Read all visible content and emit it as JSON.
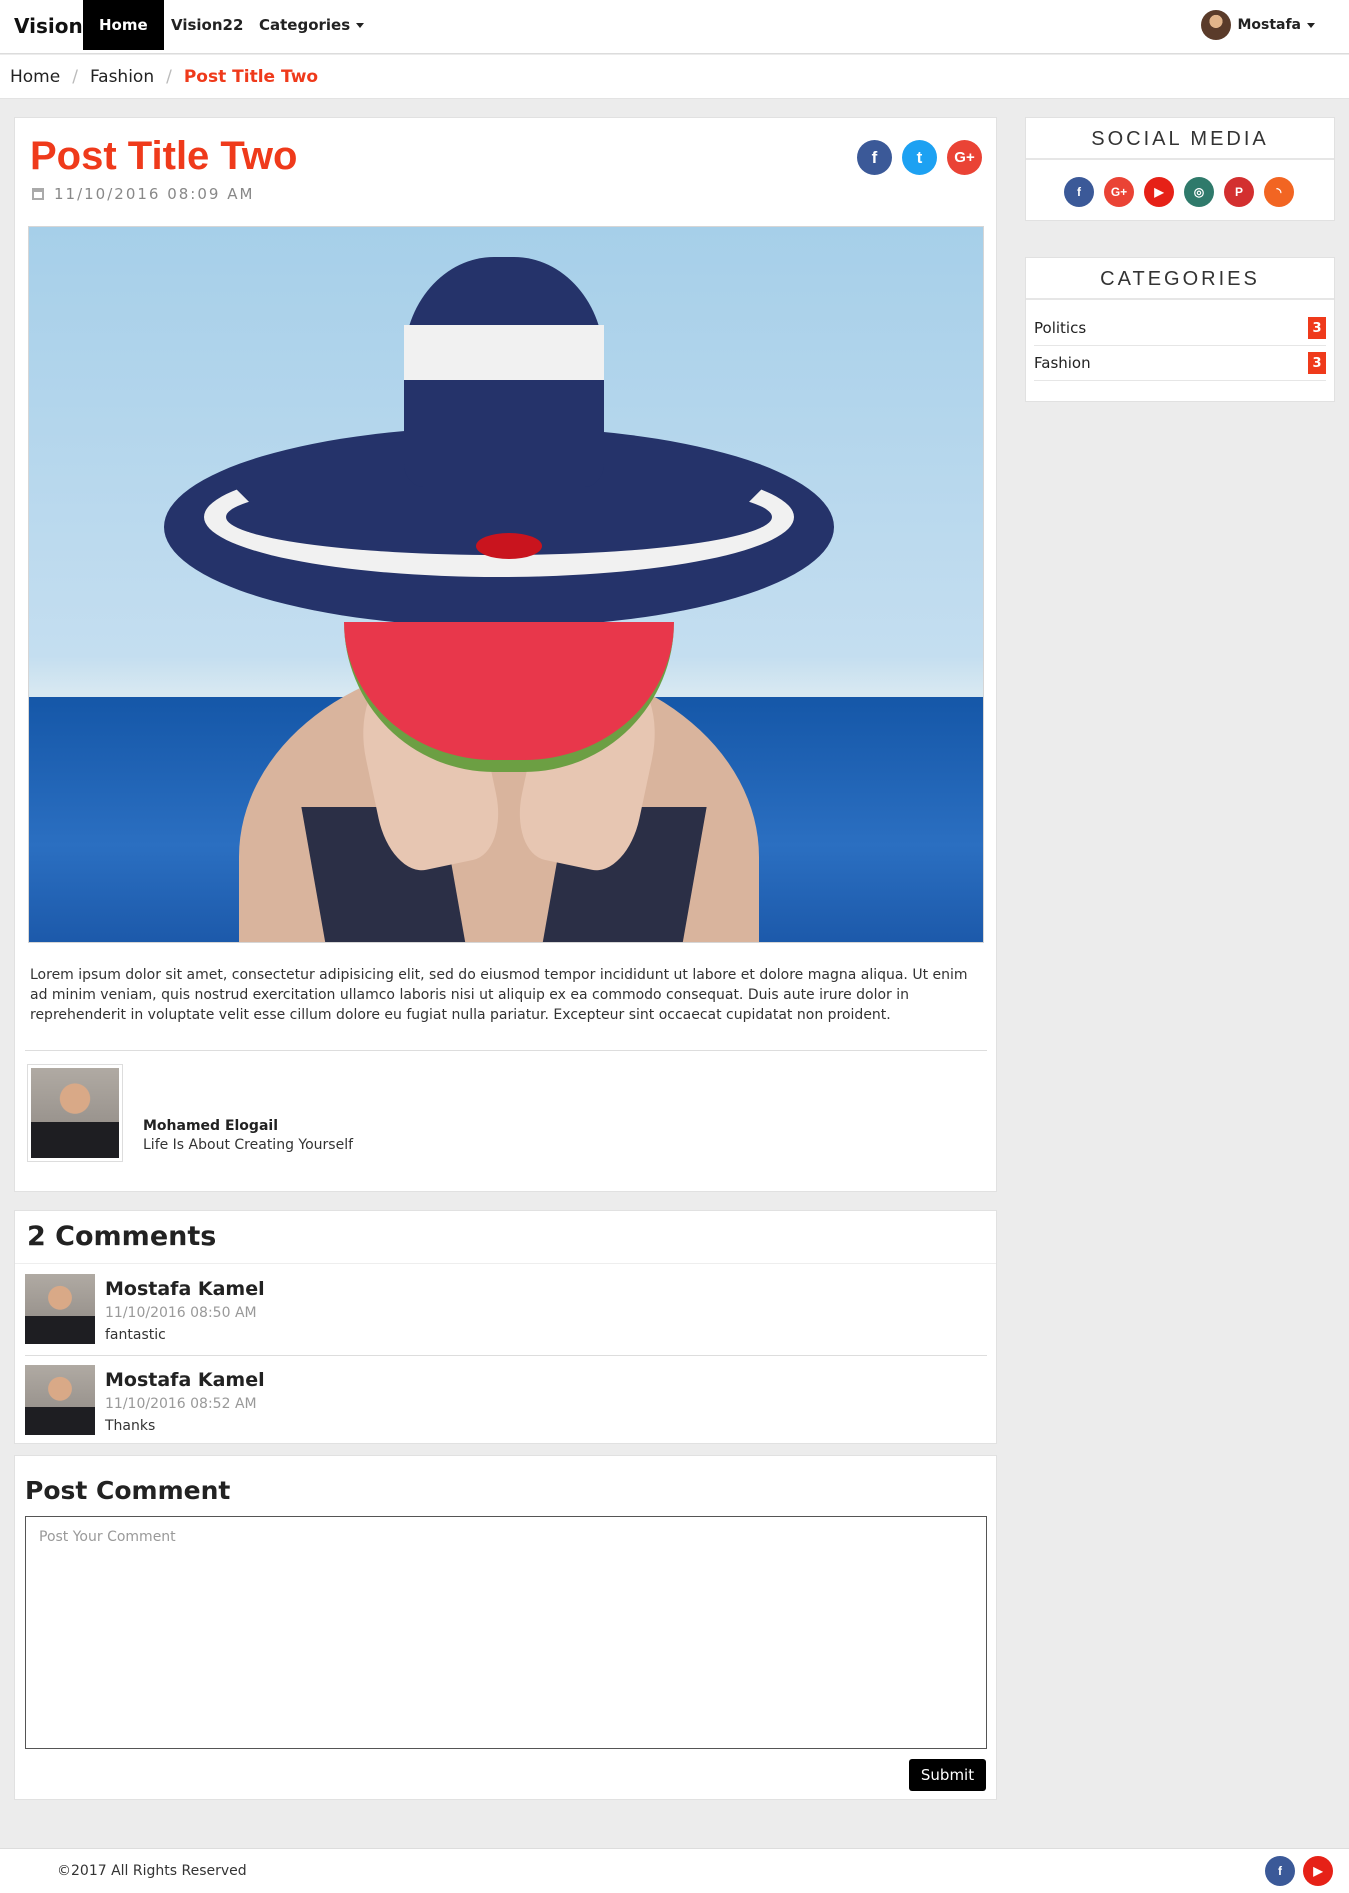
{
  "navbar": {
    "brand": "Vision",
    "links": [
      {
        "label": "Home",
        "active": true
      },
      {
        "label": "Vision22"
      },
      {
        "label": "Categories"
      }
    ],
    "user": "Mostafa"
  },
  "breadcrumb": [
    "Home",
    "Fashion",
    "Post Title Two"
  ],
  "post": {
    "title": "Post Title Two",
    "date": "11/10/2016 08:09 AM",
    "share_icons": [
      {
        "icon": "facebook-icon",
        "glyph": "f",
        "color": "#3b5998"
      },
      {
        "icon": "twitter-icon",
        "glyph": "t",
        "color": "#1da1f2"
      },
      {
        "icon": "google-plus-icon",
        "glyph": "G+",
        "color": "#ea4335"
      }
    ],
    "body": "Lorem ipsum dolor sit amet, consectetur adipisicing elit, sed do eiusmod tempor incididunt ut labore et dolore magna aliqua. Ut enim ad minim veniam, quis nostrud exercitation ullamco laboris nisi ut aliquip ex ea commodo consequat. Duis aute irure dolor in reprehenderit in voluptate velit esse cillum dolore eu fugiat nulla pariatur. Excepteur sint occaecat cupidatat non proident.",
    "author": {
      "name": "Mohamed Elogail",
      "bio": "Life Is About Creating Yourself"
    }
  },
  "comments": {
    "heading": "2 Comments",
    "items": [
      {
        "name": "Mostafa Kamel",
        "time": "11/10/2016 08:50 AM",
        "text": "fantastic"
      },
      {
        "name": "Mostafa Kamel",
        "time": "11/10/2016 08:52 AM",
        "text": "Thanks"
      }
    ]
  },
  "post_comment": {
    "heading": "Post Comment",
    "placeholder": "Post Your Comment",
    "submit": "Submit"
  },
  "sidebar": {
    "social_title": "SOCIAL MEDIA",
    "social_icons": [
      {
        "icon": "facebook-icon",
        "glyph": "f",
        "color": "#3b5998"
      },
      {
        "icon": "google-plus-icon",
        "glyph": "G+",
        "color": "#ea4335"
      },
      {
        "icon": "youtube-icon",
        "glyph": "▶",
        "color": "#e62117"
      },
      {
        "icon": "instagram-icon",
        "glyph": "◎",
        "color": "#2f7a6b"
      },
      {
        "icon": "pinterest-icon",
        "glyph": "P",
        "color": "#d32f2f"
      },
      {
        "icon": "rss-icon",
        "glyph": "◝",
        "color": "#f26522"
      }
    ],
    "categories_title": "CATEGORIES",
    "categories": [
      {
        "label": "Politics",
        "count": "3"
      },
      {
        "label": "Fashion",
        "count": "3"
      }
    ]
  },
  "footer": {
    "copyright": "©2017 All Rights Reserved",
    "social_icons": [
      {
        "icon": "facebook-icon",
        "glyph": "f",
        "color": "#3b5998"
      },
      {
        "icon": "youtube-icon",
        "glyph": "▶",
        "color": "#e62117"
      }
    ]
  }
}
